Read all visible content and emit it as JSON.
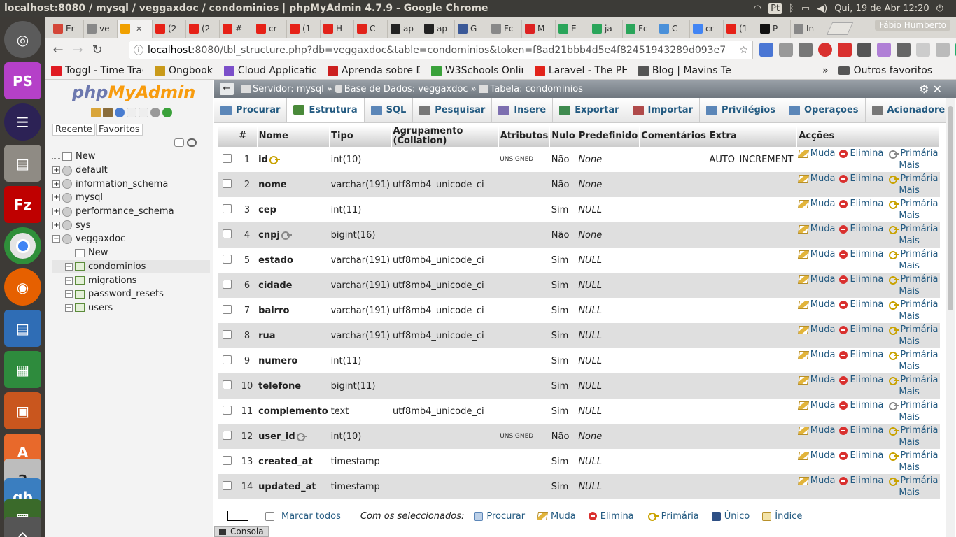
{
  "os": {
    "window_title": "localhost:8080 / mysql / veggaxdoc / condominios | phpMyAdmin 4.7.9 - Google Chrome",
    "keyboard": "Pt",
    "datetime": "Qui, 19 de Abr 12:20"
  },
  "browser": {
    "tabs": [
      {
        "label": "Er",
        "color": "#d44638"
      },
      {
        "label": "ve",
        "color": "#888888"
      },
      {
        "label": "",
        "color": "#f0a000",
        "active": true
      },
      {
        "label": "(2",
        "color": "#e62117"
      },
      {
        "label": "(2",
        "color": "#e62117"
      },
      {
        "label": "#",
        "color": "#e62117"
      },
      {
        "label": "cr",
        "color": "#e62117"
      },
      {
        "label": "(1",
        "color": "#e62117"
      },
      {
        "label": "H",
        "color": "#e2231a"
      },
      {
        "label": "C",
        "color": "#e2231a"
      },
      {
        "label": "ap",
        "color": "#222222"
      },
      {
        "label": "ap",
        "color": "#222222"
      },
      {
        "label": "G",
        "color": "#3b5998"
      },
      {
        "label": "Fc",
        "color": "#888888"
      },
      {
        "label": "M",
        "color": "#dd2222"
      },
      {
        "label": "E",
        "color": "#2aa55a"
      },
      {
        "label": "ja",
        "color": "#2aa55a"
      },
      {
        "label": "Fc",
        "color": "#2aa55a"
      },
      {
        "label": "C",
        "color": "#4a90d9"
      },
      {
        "label": "cr",
        "color": "#4285f4"
      },
      {
        "label": "(1",
        "color": "#e62117"
      },
      {
        "label": "P",
        "color": "#111111"
      },
      {
        "label": "In",
        "color": "#888888"
      }
    ],
    "profile": "Fábio Humberto",
    "url_host": "localhost",
    "url_rest": ":8080/tbl_structure.php?db=veggaxdoc&table=condominios&token=f8ad21bbb4d5e4f82451943289d093e7",
    "bookmarks": [
      {
        "label": "Toggl - Time Trac",
        "color": "#e01b22"
      },
      {
        "label": "Ongbook",
        "color": "#c99a1a"
      },
      {
        "label": "Cloud Applicatio",
        "color": "#7b4fc9"
      },
      {
        "label": "Aprenda sobre D",
        "color": "#cc1f1f"
      },
      {
        "label": "W3Schools Onlin",
        "color": "#3aa13a"
      },
      {
        "label": "Laravel - The PHP",
        "color": "#e2231a"
      },
      {
        "label": "Blog | Mavins Tec",
        "color": "#555555"
      }
    ],
    "bookmarks_more": "»",
    "other_bookmarks": "Outros favoritos"
  },
  "pma": {
    "logo_php": "php",
    "logo_my": "MyAdmin",
    "recent": "Recente",
    "favorites": "Favoritos",
    "tree": [
      {
        "label": "New",
        "kind": "new",
        "depth": 0
      },
      {
        "label": "default",
        "kind": "db",
        "depth": 0
      },
      {
        "label": "information_schema",
        "kind": "db",
        "depth": 0
      },
      {
        "label": "mysql",
        "kind": "db",
        "depth": 0
      },
      {
        "label": "performance_schema",
        "kind": "db",
        "depth": 0
      },
      {
        "label": "sys",
        "kind": "db",
        "depth": 0
      },
      {
        "label": "veggaxdoc",
        "kind": "db-open",
        "depth": 0
      },
      {
        "label": "New",
        "kind": "new",
        "depth": 1
      },
      {
        "label": "condominios",
        "kind": "table",
        "depth": 1,
        "selected": true
      },
      {
        "label": "migrations",
        "kind": "table",
        "depth": 1
      },
      {
        "label": "password_resets",
        "kind": "table",
        "depth": 1
      },
      {
        "label": "users",
        "kind": "table",
        "depth": 1
      }
    ],
    "breadcrumb": {
      "server": "Servidor: mysql",
      "database": "Base de Dados: veggaxdoc",
      "table": "Tabela: condominios"
    },
    "tabs": [
      {
        "label": "Procurar",
        "color": "#5b86b8"
      },
      {
        "label": "Estrutura",
        "color": "#4a8a3a",
        "active": true
      },
      {
        "label": "SQL",
        "color": "#5b86b8"
      },
      {
        "label": "Pesquisar",
        "color": "#777777"
      },
      {
        "label": "Insere",
        "color": "#7d6fb0"
      },
      {
        "label": "Exportar",
        "color": "#3f8a4f"
      },
      {
        "label": "Importar",
        "color": "#b04a4a"
      },
      {
        "label": "Privilégios",
        "color": "#5b86b8"
      },
      {
        "label": "Operações",
        "color": "#5b86b8"
      },
      {
        "label": "Acionadores",
        "color": "#777777"
      }
    ],
    "columns": {
      "num": "#",
      "name": "Nome",
      "type": "Tipo",
      "collation": "Agrupamento (Collation)",
      "attributes": "Atributos",
      "null": "Nulo",
      "default": "Predefinido",
      "comments": "Comentários",
      "extra": "Extra",
      "actions": "Acções"
    },
    "rows": [
      {
        "n": "1",
        "name": "id",
        "key": "primary",
        "type": "int(10)",
        "collation": "",
        "attr": "UNSIGNED",
        "null": "Não",
        "default": "None",
        "extra": "AUTO_INCREMENT",
        "prim_icon": "grey"
      },
      {
        "n": "2",
        "name": "nome",
        "key": "",
        "type": "varchar(191)",
        "collation": "utf8mb4_unicode_ci",
        "attr": "",
        "null": "Não",
        "default": "None",
        "extra": "",
        "prim_icon": "gold"
      },
      {
        "n": "3",
        "name": "cep",
        "key": "",
        "type": "int(11)",
        "collation": "",
        "attr": "",
        "null": "Sim",
        "default": "NULL",
        "extra": "",
        "prim_icon": "gold"
      },
      {
        "n": "4",
        "name": "cnpj",
        "key": "index",
        "type": "bigint(16)",
        "collation": "",
        "attr": "",
        "null": "Não",
        "default": "None",
        "extra": "",
        "prim_icon": "gold"
      },
      {
        "n": "5",
        "name": "estado",
        "key": "",
        "type": "varchar(191)",
        "collation": "utf8mb4_unicode_ci",
        "attr": "",
        "null": "Sim",
        "default": "NULL",
        "extra": "",
        "prim_icon": "gold"
      },
      {
        "n": "6",
        "name": "cidade",
        "key": "",
        "type": "varchar(191)",
        "collation": "utf8mb4_unicode_ci",
        "attr": "",
        "null": "Sim",
        "default": "NULL",
        "extra": "",
        "prim_icon": "gold"
      },
      {
        "n": "7",
        "name": "bairro",
        "key": "",
        "type": "varchar(191)",
        "collation": "utf8mb4_unicode_ci",
        "attr": "",
        "null": "Sim",
        "default": "NULL",
        "extra": "",
        "prim_icon": "gold"
      },
      {
        "n": "8",
        "name": "rua",
        "key": "",
        "type": "varchar(191)",
        "collation": "utf8mb4_unicode_ci",
        "attr": "",
        "null": "Sim",
        "default": "NULL",
        "extra": "",
        "prim_icon": "gold"
      },
      {
        "n": "9",
        "name": "numero",
        "key": "",
        "type": "int(11)",
        "collation": "",
        "attr": "",
        "null": "Sim",
        "default": "NULL",
        "extra": "",
        "prim_icon": "gold"
      },
      {
        "n": "10",
        "name": "telefone",
        "key": "",
        "type": "bigint(11)",
        "collation": "",
        "attr": "",
        "null": "Sim",
        "default": "NULL",
        "extra": "",
        "prim_icon": "gold"
      },
      {
        "n": "11",
        "name": "complemento",
        "key": "",
        "type": "text",
        "collation": "utf8mb4_unicode_ci",
        "attr": "",
        "null": "Sim",
        "default": "NULL",
        "extra": "",
        "prim_icon": "grey"
      },
      {
        "n": "12",
        "name": "user_id",
        "key": "index",
        "type": "int(10)",
        "collation": "",
        "attr": "UNSIGNED",
        "null": "Não",
        "default": "None",
        "extra": "",
        "prim_icon": "gold"
      },
      {
        "n": "13",
        "name": "created_at",
        "key": "",
        "type": "timestamp",
        "collation": "",
        "attr": "",
        "null": "Sim",
        "default": "NULL",
        "extra": "",
        "prim_icon": "gold"
      },
      {
        "n": "14",
        "name": "updated_at",
        "key": "",
        "type": "timestamp",
        "collation": "",
        "attr": "",
        "null": "Sim",
        "default": "NULL",
        "extra": "",
        "prim_icon": "gold"
      }
    ],
    "actions": {
      "change": "Muda",
      "drop": "Elimina",
      "primary": "Primária",
      "more": "Mais"
    },
    "bottom": {
      "check_all": "Marcar todos",
      "with_selected": "Com os seleccionados:",
      "browse": "Procurar",
      "change": "Muda",
      "drop": "Elimina",
      "primary": "Primária",
      "unique": "Único",
      "index": "Índice"
    },
    "console": "Consola"
  }
}
